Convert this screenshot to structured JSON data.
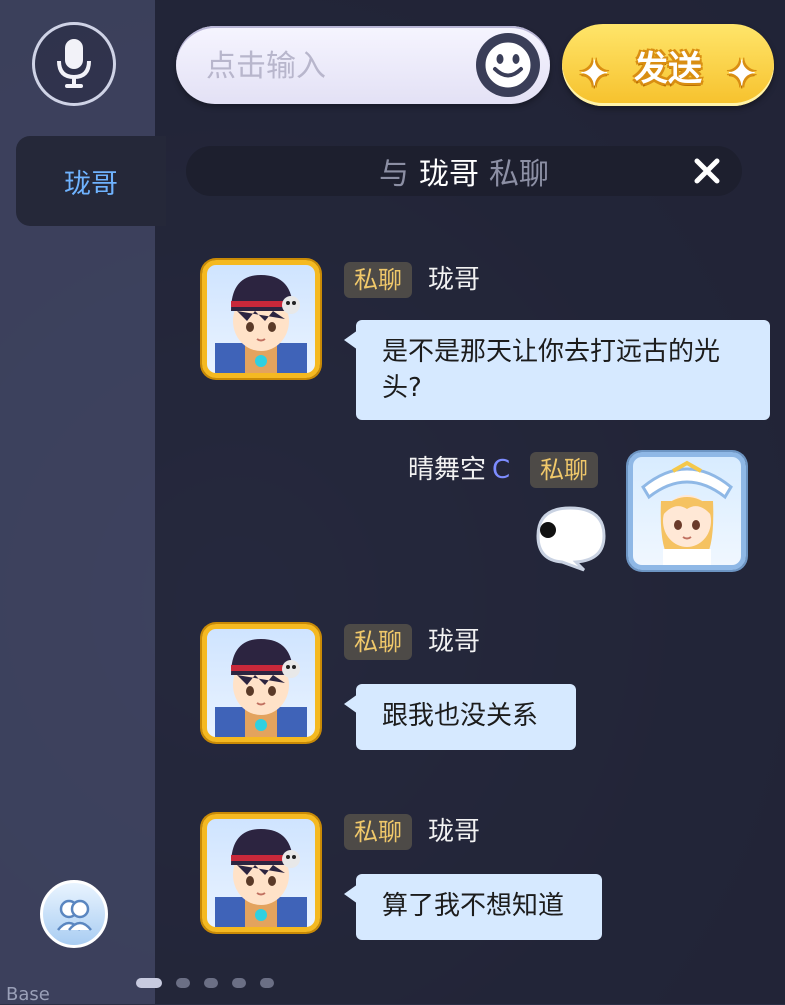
{
  "topbar": {
    "input_placeholder": "点击输入",
    "send_label": "发送",
    "mic_icon": "microphone-icon",
    "emoji_icon": "smiley-icon"
  },
  "sidebar": {
    "contacts": [
      {
        "name": "珑哥",
        "selected": true
      }
    ]
  },
  "chat": {
    "header_prefix": "与",
    "header_name": "珑哥",
    "header_suffix": "私聊",
    "close_icon": "close-icon",
    "messages": [
      {
        "side": "left",
        "tag": "私聊",
        "sender": "珑哥",
        "text": "是不是那天让你去打远古的光头?"
      },
      {
        "side": "right",
        "tag": "私聊",
        "sender": "晴舞空",
        "badge": "C",
        "sticker": "speech-bubble-sticker-icon"
      },
      {
        "side": "left",
        "tag": "私聊",
        "sender": "珑哥",
        "text": "跟我也没关系"
      },
      {
        "side": "left",
        "tag": "私聊",
        "sender": "珑哥",
        "text": "算了我不想知道"
      }
    ]
  },
  "bottom": {
    "friends_icon": "friends-icon",
    "base_label": "Base",
    "page_dots": 5
  },
  "colors": {
    "send_button": "#f6c12c",
    "bubble": "#d6e9ff",
    "tag_text": "#f0c86a",
    "contact_selected": "#6fb3ff",
    "c_badge": "#7d8cff"
  }
}
